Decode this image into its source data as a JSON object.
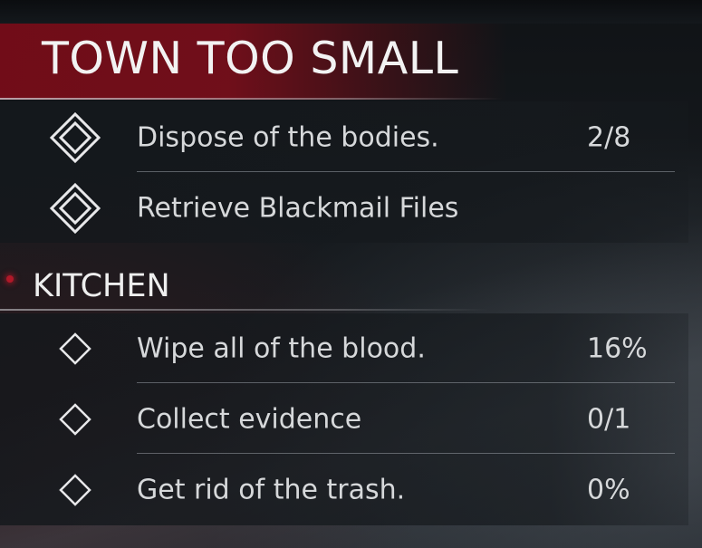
{
  "quest": {
    "title": "TOWN TOO SMALL",
    "objectives": [
      {
        "label": "Dispose of the bodies.",
        "progress": "2/8",
        "icon": "double-diamond-icon"
      },
      {
        "label": "Retrieve Blackmail Files",
        "progress": "",
        "icon": "double-diamond-icon"
      }
    ]
  },
  "section": {
    "title": "KITCHEN",
    "tasks": [
      {
        "label": "Wipe all of the blood.",
        "progress": "16%",
        "icon": "diamond-outline-icon"
      },
      {
        "label": "Collect evidence",
        "progress": "0/1",
        "icon": "diamond-outline-icon"
      },
      {
        "label": "Get rid of the trash.",
        "progress": "0%",
        "icon": "diamond-outline-icon"
      }
    ]
  },
  "colors": {
    "accent_red": "#7a0e1a",
    "text": "#d6d8da",
    "title_text": "#f2f2f2"
  }
}
